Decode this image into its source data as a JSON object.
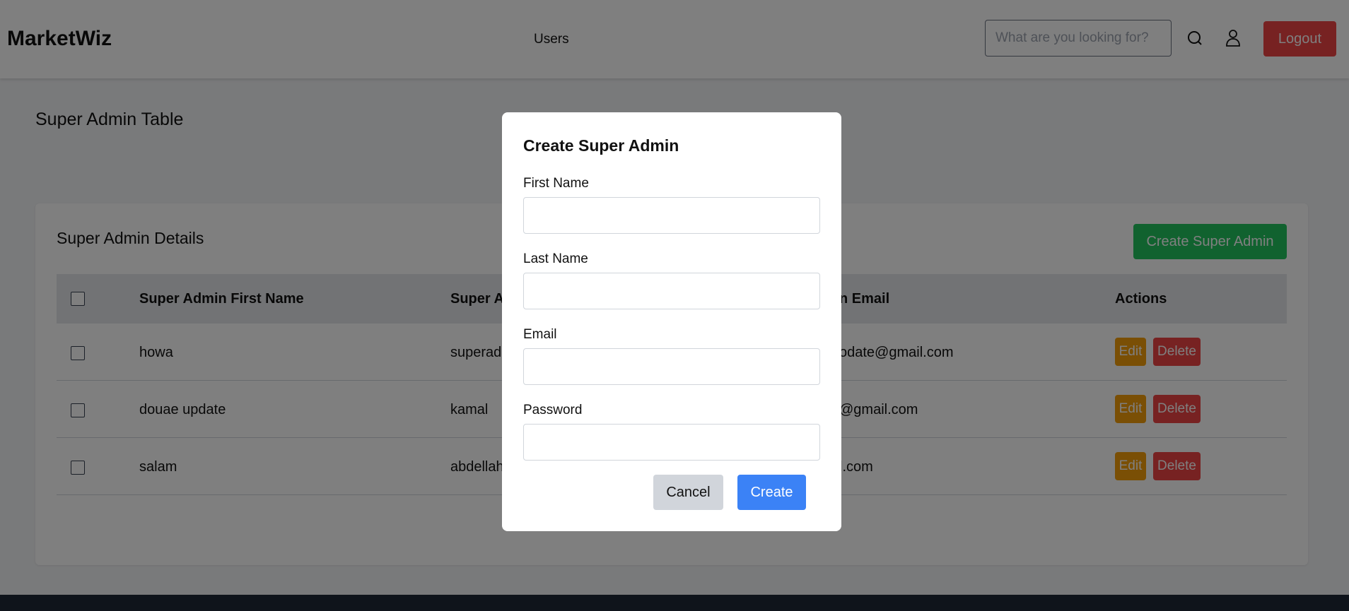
{
  "header": {
    "brand": "MarketWiz",
    "nav_users": "Users",
    "search_placeholder": "What are you looking for?",
    "search_icon": "search-icon",
    "user_icon": "user-icon",
    "logout_label": "Logout"
  },
  "page": {
    "title": "Super Admin Table",
    "card_title": "Super Admin Details",
    "create_button": "Create Super Admin"
  },
  "table": {
    "headers": [
      "Super Admin First Name",
      "Super A",
      "n Email",
      "Actions"
    ],
    "rows": [
      {
        "first_name": "howa",
        "last_name": "superad",
        "email": "odate@gmail.com"
      },
      {
        "first_name": "douae update",
        "last_name": "kamal",
        "email": "@gmail.com"
      },
      {
        "first_name": "salam",
        "last_name": "abdellah",
        "email": "l.com"
      }
    ],
    "edit_label": "Edit",
    "delete_label": "Delete"
  },
  "modal": {
    "title": "Create Super Admin",
    "fields": [
      {
        "label": "First Name",
        "value": ""
      },
      {
        "label": "Last Name",
        "value": ""
      },
      {
        "label": "Email",
        "value": ""
      },
      {
        "label": "Password",
        "value": ""
      }
    ],
    "cancel_label": "Cancel",
    "submit_label": "Create"
  },
  "colors": {
    "danger": "#ef4444",
    "success": "#22c55e",
    "warning": "#f59e0b",
    "primary": "#3b82f6",
    "footer": "#1f2937"
  }
}
